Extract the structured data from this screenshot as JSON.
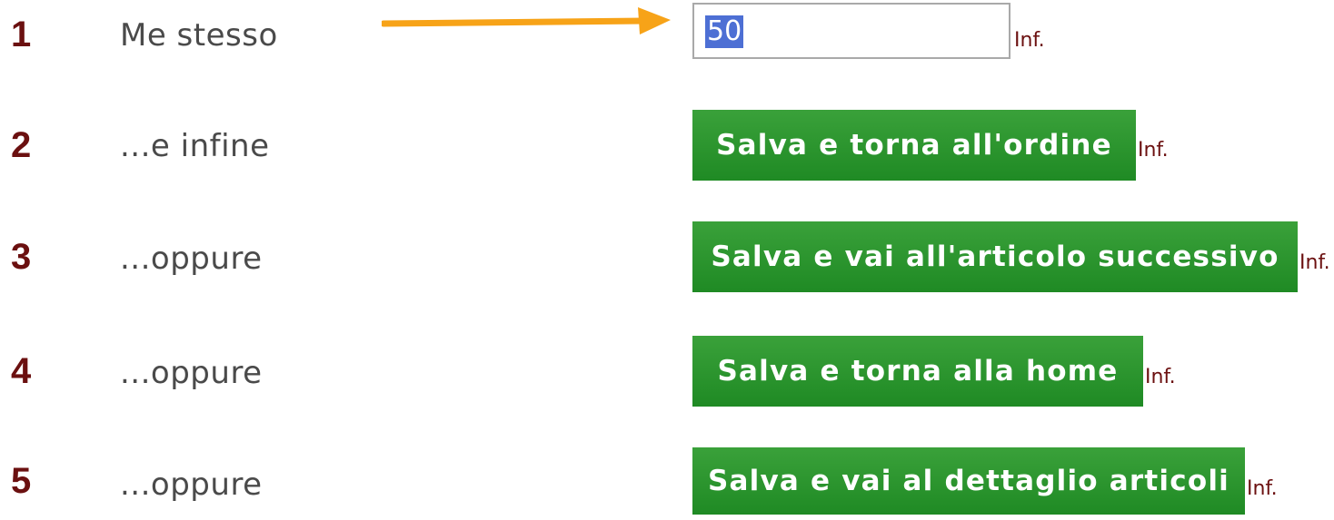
{
  "colors": {
    "step_number": "#6b1010",
    "label_text": "#4a4a4a",
    "button_green": "#229326",
    "arrow_orange": "#f7a318",
    "selection_blue": "#4d6fd4"
  },
  "rows": [
    {
      "number": "1",
      "label": "Me stesso",
      "input_value": "50",
      "info": "Inf."
    },
    {
      "number": "2",
      "label": "...e infine",
      "button": "Salva e torna all'ordine",
      "info": "Inf."
    },
    {
      "number": "3",
      "label": "...oppure",
      "button": "Salva e vai all'articolo successivo",
      "info": "Inf."
    },
    {
      "number": "4",
      "label": "...oppure",
      "button": "Salva e torna alla home",
      "info": "Inf."
    },
    {
      "number": "5",
      "label": "...oppure",
      "button": "Salva e vai al dettaglio articoli",
      "info": "Inf."
    }
  ],
  "icons": {
    "pointer_arrow": "arrow-right-icon"
  }
}
